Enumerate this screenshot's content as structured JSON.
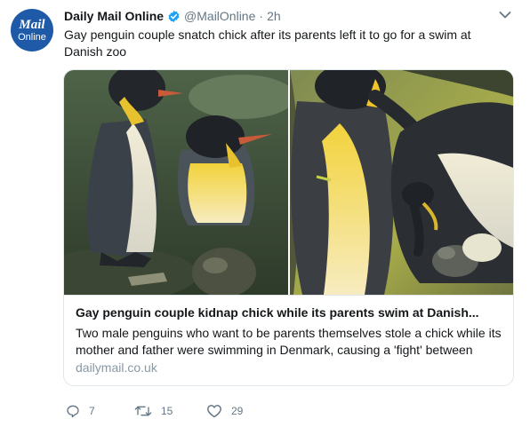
{
  "account": {
    "avatar_line1": "Mail",
    "avatar_line2": "Online",
    "name": "Daily Mail Online",
    "handle": "@MailOnline",
    "separator": "·",
    "time": "2h"
  },
  "tweet": {
    "text": "Gay penguin couple snatch chick after its parents left it to go for a swim at Danish zoo"
  },
  "card": {
    "title": "Gay penguin couple kidnap chick while its parents swim at Danish...",
    "description": "Two male penguins who want to be parents themselves stole a chick while its mother and father were swimming in Denmark, causing a 'fight' between",
    "domain": "dailymail.co.uk"
  },
  "actions": {
    "reply_count": "7",
    "retweet_count": "15",
    "like_count": "29"
  },
  "colors": {
    "brand_blue": "#1f5aa8",
    "verified_blue": "#1da1f2",
    "muted_text": "#657786"
  }
}
